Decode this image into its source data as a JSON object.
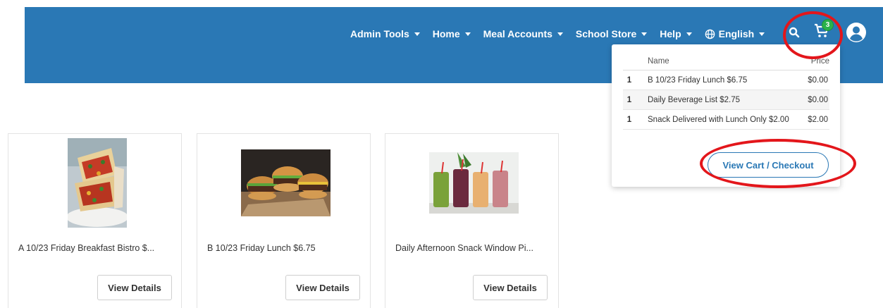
{
  "nav": {
    "items": [
      {
        "label": "Admin Tools"
      },
      {
        "label": "Home"
      },
      {
        "label": "Meal Accounts"
      },
      {
        "label": "School Store"
      },
      {
        "label": "Help"
      },
      {
        "label": "English"
      }
    ],
    "cart_count": "3",
    "icons": [
      "search-icon",
      "cart-icon",
      "user-avatar-icon",
      "globe-icon"
    ]
  },
  "cart_dropdown": {
    "headers": {
      "name": "Name",
      "price": "Price"
    },
    "rows": [
      {
        "qty": "1",
        "name": "B 10/23 Friday Lunch $6.75",
        "price": "$0.00"
      },
      {
        "qty": "1",
        "name": "Daily Beverage List $2.75",
        "price": "$0.00"
      },
      {
        "qty": "1",
        "name": "Snack Delivered with Lunch Only $2.00",
        "price": "$2.00"
      }
    ],
    "checkout_label": "View Cart / Checkout"
  },
  "products": [
    {
      "title": "A 10/23 Friday Breakfast Bistro $...",
      "button": "View Details"
    },
    {
      "title": "B 10/23 Friday Lunch $6.75",
      "button": "View Details"
    },
    {
      "title": "Daily Afternoon Snack Window Pi...",
      "button": "View Details"
    }
  ],
  "colors": {
    "header": "#2a78b5",
    "badge": "#2ab24a",
    "annotation": "#e3161b"
  }
}
